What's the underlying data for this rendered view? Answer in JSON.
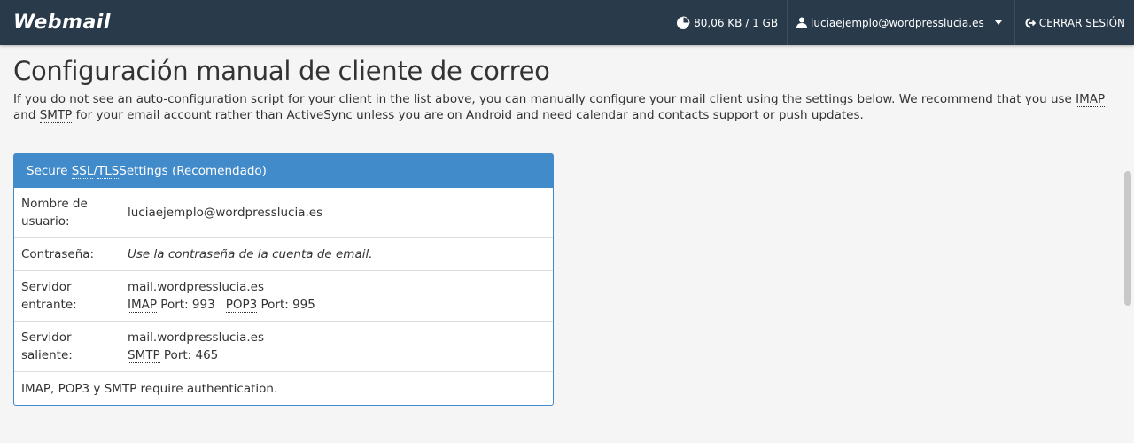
{
  "app": {
    "logo": "Webmail"
  },
  "topbar": {
    "disk_usage": "80,06 KB / 1 GB",
    "user": "luciaejemplo@wordpresslucia.es",
    "logout": "CERRAR SESIÓN"
  },
  "page": {
    "title": "Configuración manual de cliente de correo",
    "intro_part1": "If you do not see an auto-configuration script for your client in the list above, you can manually configure your mail client using the settings below. We recommend that you use ",
    "intro_imap": "IMAP",
    "intro_and": " and ",
    "intro_smtp": "SMTP",
    "intro_part2": " for your email account rather than ActiveSync unless you are on Android and need calendar and contacts support or push updates."
  },
  "panel": {
    "heading_prefix": "Secure ",
    "heading_ssl": "SSL",
    "heading_slash": "/",
    "heading_tls": "TLS",
    "heading_suffix": " Settings (Recomendado)",
    "username_label": "Nombre de usuario:",
    "username_value": "luciaejemplo@wordpresslucia.es",
    "password_label": "Contraseña:",
    "password_value": "Use la contraseña de la cuenta de email.",
    "incoming_label": "Servidor entrante:",
    "incoming_host": "mail.wordpresslucia.es",
    "incoming_imap": "IMAP",
    "incoming_imap_port": " Port: 993",
    "incoming_pop3": "POP3",
    "incoming_pop3_port": " Port: 995",
    "outgoing_label": "Servidor saliente:",
    "outgoing_host": "mail.wordpresslucia.es",
    "outgoing_smtp": "SMTP",
    "outgoing_smtp_port": " Port: 465",
    "auth_note": "IMAP, POP3 y SMTP require authentication."
  },
  "colors": {
    "topbar_bg": "#293a4a",
    "panel_accent": "#428bca"
  }
}
